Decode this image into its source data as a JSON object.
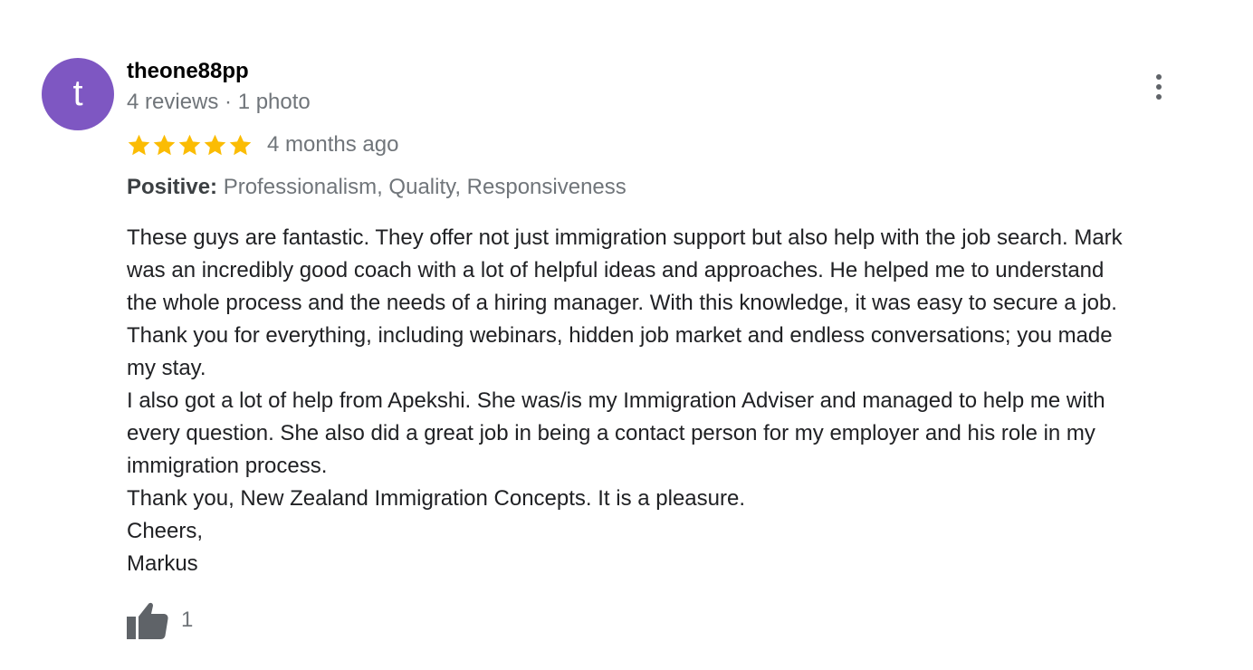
{
  "review": {
    "author": {
      "avatar_initial": "t",
      "avatar_color": "#7e57c2",
      "name": "theone88pp",
      "meta": "4 reviews · 1 photo"
    },
    "rating": 5,
    "rating_max": 5,
    "star_color": "#fbbc04",
    "time_ago": "4 months ago",
    "attributes": {
      "label": "Positive:",
      "values": "Professionalism, Quality, Responsiveness"
    },
    "text_lines": [
      "These guys are fantastic. They offer not just immigration support but also help with the job search. Mark",
      "was an incredibly good coach with a lot of helpful ideas and approaches. He helped me to understand",
      "the whole process and the needs of a hiring manager. With this knowledge, it was easy to secure a job.",
      "Thank you for everything, including webinars, hidden job market and endless conversations; you made",
      "my stay.",
      "I also got a lot of help from Apekshi. She was/is my Immigration Adviser and managed to help me with",
      "every question. She also did a great job in being a contact person for my employer and his role in my",
      "immigration process.",
      "Thank you, New Zealand Immigration Concepts. It is a pleasure.",
      "Cheers,",
      "Markus"
    ],
    "likes": "1",
    "icons": {
      "more": "more-vert-icon",
      "like": "thumb-up-icon",
      "star": "star-icon"
    }
  }
}
